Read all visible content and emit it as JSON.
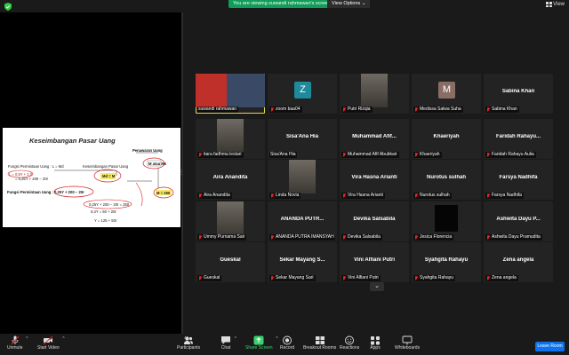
{
  "top": {
    "banner_text": "You are viewing suwandi rahmawan's screen",
    "view_options_label": "View Options ⌄",
    "view_button_label": "View"
  },
  "slide": {
    "title": "Keseimbangan Pasar Uang",
    "texts": [
      "Fungsi Permintaan Uang : L = Md",
      "L = 0,5Y + 1,0",
      "= 0,25Y + 200 − 20r",
      "Keseimbangan Pasar Uang",
      "Md = M",
      "Penawaran Uang",
      "M atau Ms",
      "Fungsi Permintaan Uang : 0,25Y + 200 − 20r",
      "M = 250",
      "0,25Y + 200 − 20r = 250",
      "0,4Y = 50 + 20r",
      "Y = 125 + 50r"
    ]
  },
  "participants": [
    {
      "name": "suwandi rahmawan",
      "display": "",
      "type": "video",
      "active": true,
      "muted": false
    },
    {
      "name": "zoom baa04",
      "display": "",
      "type": "avatar",
      "letter": "Z",
      "color": "#1e8a9c",
      "muted": true
    },
    {
      "name": "Putri Rizqia",
      "display": "",
      "type": "photo",
      "muted": true
    },
    {
      "name": "Medissa Salwa Suha",
      "display": "",
      "type": "avatar",
      "letter": "M",
      "color": "#8a6e66",
      "muted": true
    },
    {
      "name": "Sabina Khan",
      "display": "Sabina Khan",
      "type": "name",
      "muted": true
    },
    {
      "name": "tiara fadhma lestari",
      "display": "",
      "type": "photo",
      "muted": true
    },
    {
      "name": "Sisa'Ana Hia",
      "display": "Sisa'Ana Hia",
      "type": "name",
      "muted": false
    },
    {
      "name": "Muhammad Afif Abubkair",
      "display": "Muhammad Afif...",
      "type": "name",
      "muted": true
    },
    {
      "name": "Khaeriyah",
      "display": "Khaeriyah",
      "type": "name",
      "muted": true
    },
    {
      "name": "Faridah Rahayu Aulia",
      "display": "Faridah Rahayu...",
      "type": "name",
      "muted": true
    },
    {
      "name": "Aira Anandita",
      "display": "Aira Anandita",
      "type": "name",
      "muted": true
    },
    {
      "name": "Linda Novia",
      "display": "",
      "type": "photo",
      "muted": true
    },
    {
      "name": "Vira Hasna Arianti",
      "display": "Vira Hasna Arianti",
      "type": "name",
      "muted": true
    },
    {
      "name": "Nurotus sulhah",
      "display": "Nurotus sulhah",
      "type": "name",
      "muted": true
    },
    {
      "name": "Farsya Nadhifa",
      "display": "Farsya Nadhifa",
      "type": "name",
      "muted": true
    },
    {
      "name": "Ummy Purnama Sari",
      "display": "",
      "type": "photo",
      "muted": true
    },
    {
      "name": "ANANDA PUTRA IMANSYAH",
      "display": "ANANDA PUTR...",
      "type": "name",
      "muted": true
    },
    {
      "name": "Devika Salsabila",
      "display": "Devika Salsabila",
      "type": "name",
      "muted": true
    },
    {
      "name": "Jesica Florencia",
      "display": "",
      "type": "dark",
      "muted": true
    },
    {
      "name": "Ashwita Dayu Pramudita",
      "display": "Ashwita Dayu P...",
      "type": "name",
      "muted": true
    },
    {
      "name": "Gueskal",
      "display": "Gueskal",
      "type": "name",
      "muted": true
    },
    {
      "name": "Sekar Mayang Sari",
      "display": "Sekar Mayang S...",
      "type": "name",
      "muted": true
    },
    {
      "name": "Vini Alfiani Putri",
      "display": "Vini Alfiani Putri",
      "type": "name",
      "muted": true
    },
    {
      "name": "Syahgita Rahayu",
      "display": "Syahgita Rahayu",
      "type": "name",
      "muted": true
    },
    {
      "name": "Zena angela",
      "display": "Zena angela",
      "type": "name",
      "muted": true
    }
  ],
  "toolbar": {
    "unmute": "Unmute",
    "start_video": "Start Video",
    "participants": "Participants",
    "participants_count": "41",
    "chat": "Chat",
    "share_screen": "Share Screen",
    "record": "Record",
    "breakout": "Breakout Rooms",
    "reactions": "Reactions",
    "apps": "Apps",
    "whiteboards": "Whiteboards",
    "leave": "Leave Room"
  },
  "colors": {
    "share_green": "#3bd16f",
    "leave_blue": "#0e72ed",
    "active_border": "#e5d84a",
    "banner_green": "#0f9d58"
  }
}
